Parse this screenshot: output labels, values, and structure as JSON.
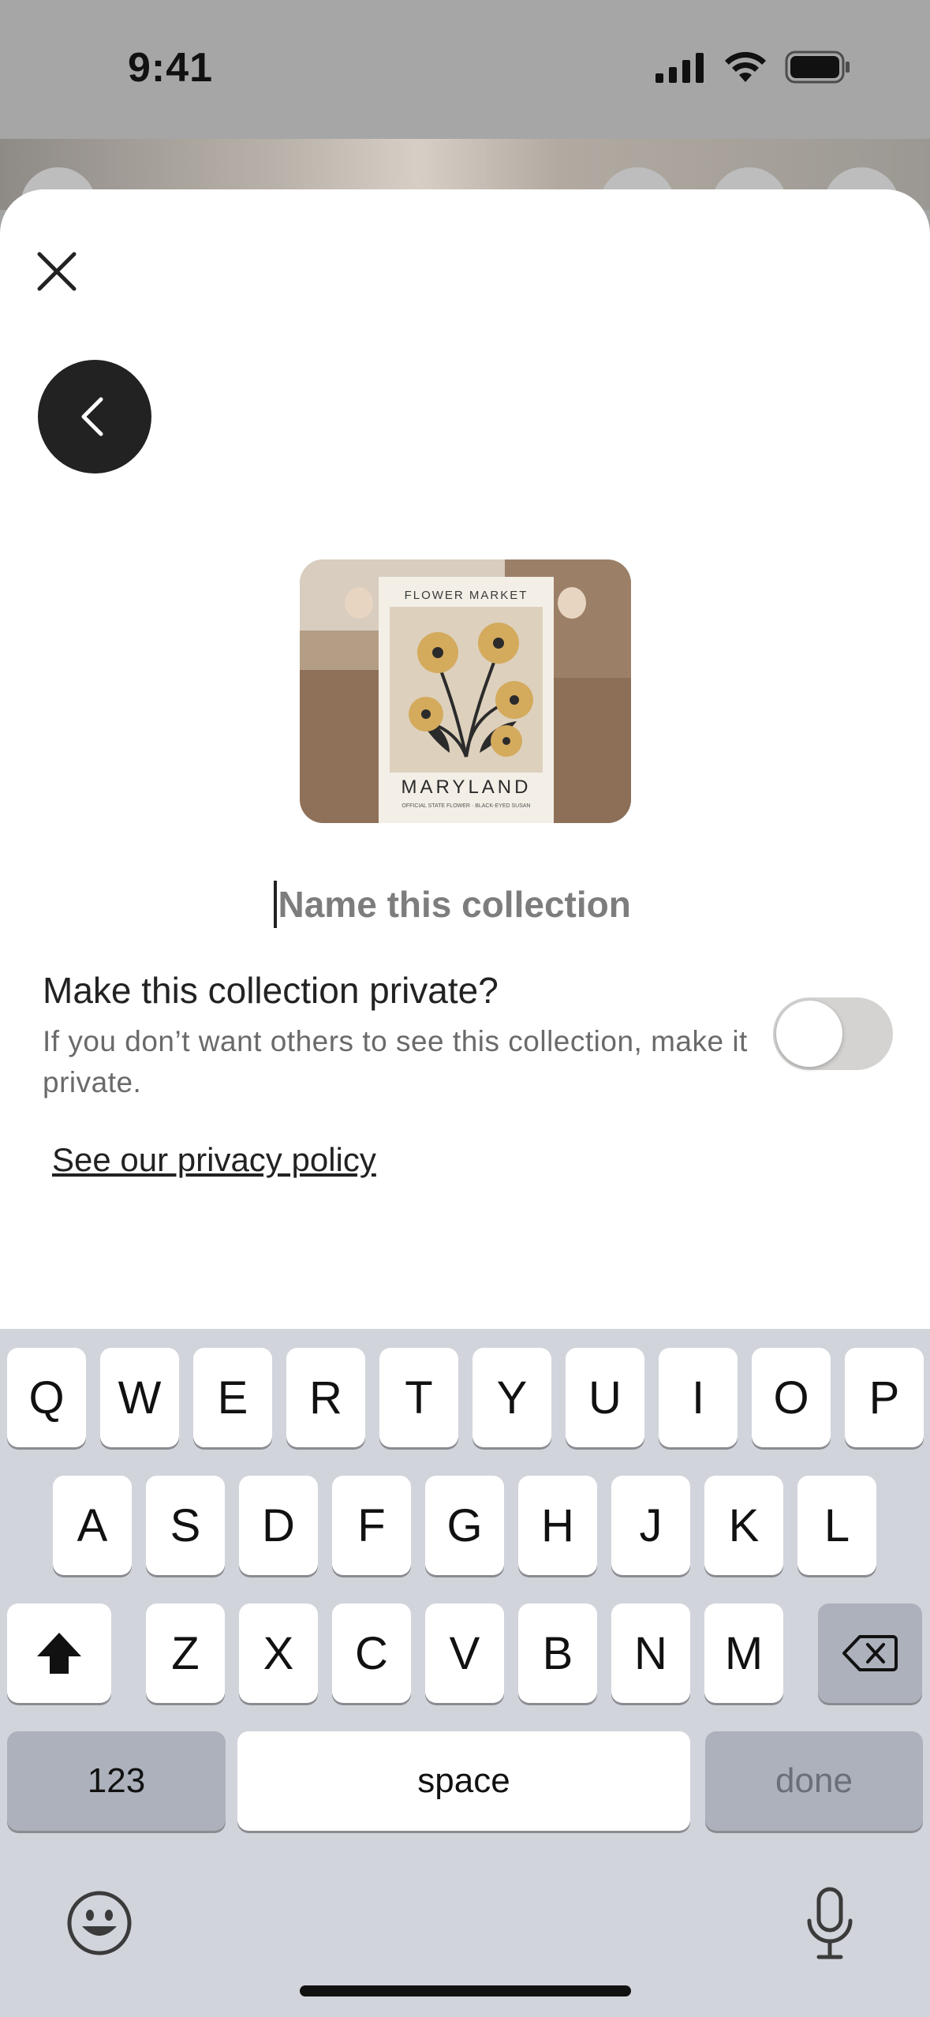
{
  "status_bar": {
    "time": "9:41"
  },
  "header": {
    "close_icon": "close-icon",
    "back_icon": "chevron-left-icon"
  },
  "thumbnail": {
    "poster_title": "FLOWER MARKET",
    "poster_state": "MARYLAND",
    "poster_caption": "OFFICIAL STATE FLOWER · BLACK-EYED SUSAN"
  },
  "collection_name": {
    "value": "",
    "placeholder": "Name this collection"
  },
  "privacy": {
    "title": "Make this collection private?",
    "description": "If you don’t want others to see this collection, make it private.",
    "toggle_on": false,
    "policy_link": "See our privacy policy"
  },
  "keyboard": {
    "row1": [
      "Q",
      "W",
      "E",
      "R",
      "T",
      "Y",
      "U",
      "I",
      "O",
      "P"
    ],
    "row2": [
      "A",
      "S",
      "D",
      "F",
      "G",
      "H",
      "J",
      "K",
      "L"
    ],
    "row3": [
      "Z",
      "X",
      "C",
      "V",
      "B",
      "N",
      "M"
    ],
    "numbers_label": "123",
    "space_label": "space",
    "done_label": "done",
    "shift_icon": "shift-icon",
    "delete_icon": "delete-icon",
    "emoji_icon": "emoji-icon",
    "mic_icon": "microphone-icon"
  },
  "colors": {
    "sheet": "#ffffff",
    "back_button": "#222222",
    "keyboard_bg": "#d1d4db",
    "toggle_off": "#d4d3d1"
  }
}
